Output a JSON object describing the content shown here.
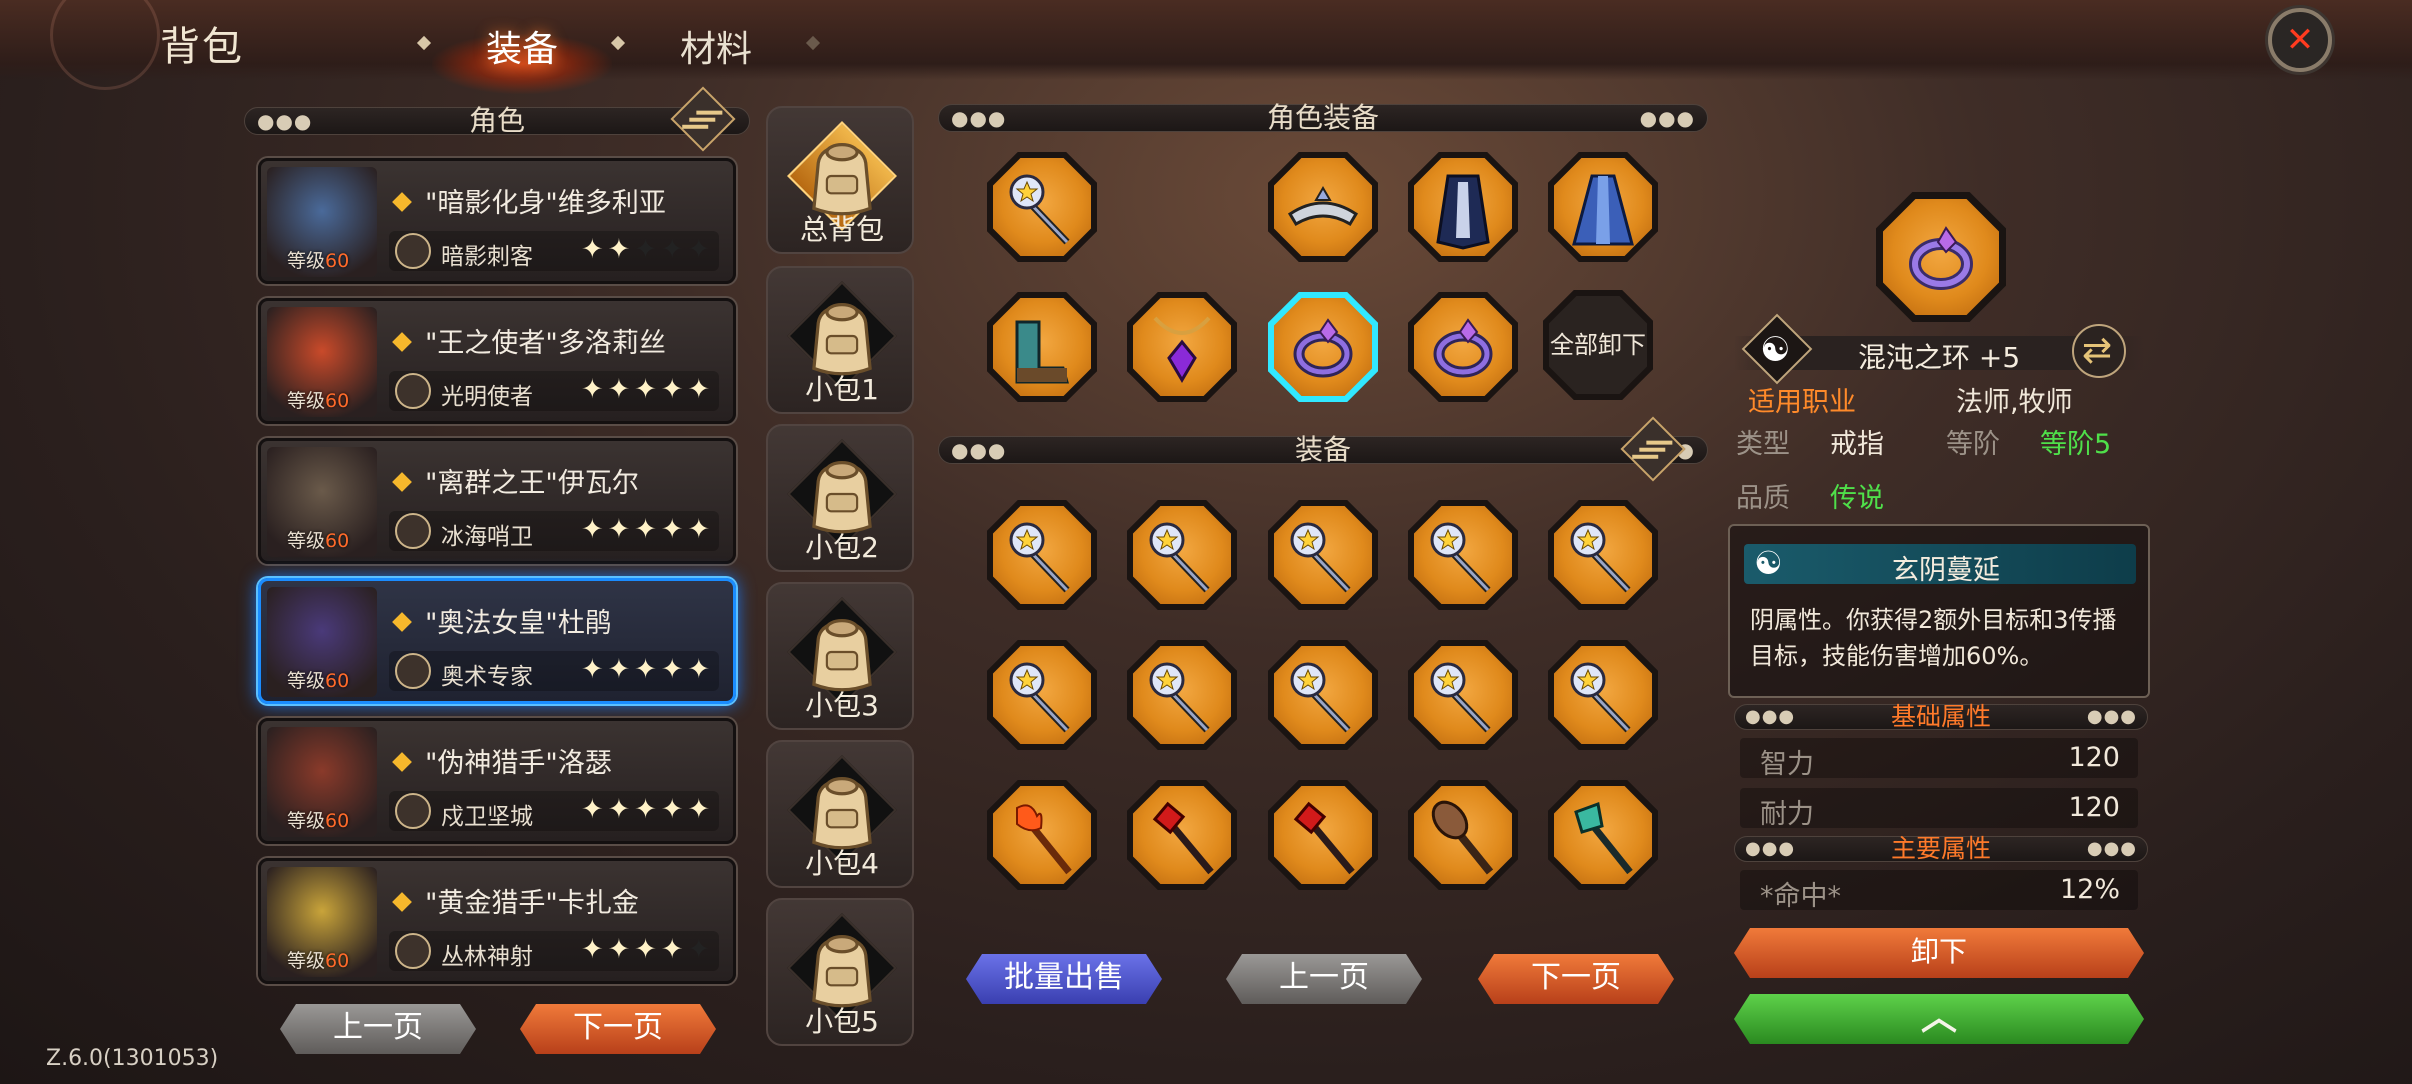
{
  "header": {
    "title": "背包",
    "tabs": [
      "装备",
      "材料"
    ],
    "active_tab": 0,
    "close_icon": "close-icon"
  },
  "left": {
    "section_title": "角色",
    "characters": [
      {
        "name": "\"暗影化身\"维多利亚",
        "level_label": "等级",
        "level": "60",
        "class": "暗影刺客",
        "stars": 2,
        "selected": false
      },
      {
        "name": "\"王之使者\"多洛莉丝",
        "level_label": "等级",
        "level": "60",
        "class": "光明使者",
        "stars": 5,
        "selected": false
      },
      {
        "name": "\"离群之王\"伊瓦尔",
        "level_label": "等级",
        "level": "60",
        "class": "冰海哨卫",
        "stars": 5,
        "selected": false
      },
      {
        "name": "\"奥法女皇\"杜鹃",
        "level_label": "等级",
        "level": "60",
        "class": "奥术专家",
        "stars": 5,
        "selected": true
      },
      {
        "name": "\"伪神猎手\"洛瑟",
        "level_label": "等级",
        "level": "60",
        "class": "戍卫坚城",
        "stars": 5,
        "selected": false
      },
      {
        "name": "\"黄金猎手\"卡扎金",
        "level_label": "等级",
        "level": "60",
        "class": "丛林神射",
        "stars": 4,
        "selected": false
      }
    ],
    "prev_label": "上一页",
    "next_label": "下一页"
  },
  "bags": [
    "总背包",
    "小包1",
    "小包2",
    "小包3",
    "小包4",
    "小包5"
  ],
  "equipped": {
    "section_title": "角色装备",
    "row1": [
      "staff-icon",
      "",
      "tiara-icon",
      "cloak-icon",
      "robe-icon"
    ],
    "row2": [
      "boots-icon",
      "amulet-icon",
      "ring-icon",
      "ring-icon"
    ],
    "unequip_all_label": "全部卸下"
  },
  "inventory": {
    "section_title": "装备",
    "items": [
      "staff-icon",
      "staff-icon",
      "staff-icon",
      "staff-icon",
      "staff-icon",
      "staff-icon",
      "staff-icon",
      "staff-icon",
      "staff-icon",
      "staff-icon",
      "fire-staff-icon",
      "red-wand-icon",
      "red-wand-icon",
      "club-icon",
      "jade-staff-icon"
    ],
    "bulk_sell_label": "批量出售",
    "prev_label": "上一页",
    "next_label": "下一页"
  },
  "detail": {
    "item_name": "混沌之环 +5",
    "class_label": "适用职业",
    "class_value": "法师,牧师",
    "type_label": "类型",
    "type_value": "戒指",
    "tier_label": "等阶",
    "tier_value": "等阶5",
    "quality_label": "品质",
    "quality_value": "传说",
    "effect_title": "玄阴蔓延",
    "effect_text": "阴属性。你获得2额外目标和3传播目标，技能伤害增加60%。",
    "basic_title": "基础属性",
    "basic_stats": [
      {
        "name": "智力",
        "value": "120"
      },
      {
        "name": "耐力",
        "value": "120"
      }
    ],
    "main_title": "主要属性",
    "main_stats": [
      {
        "name": "*命中*",
        "value": "12%"
      }
    ],
    "unequip_label": "卸下",
    "upgrade_icon": "chevron-up-icon"
  },
  "version": "Z.6.0(1301053)",
  "colors": {
    "accent_orange": "#ff7a2a",
    "selected_blue": "#1a8cff",
    "slot_orange": "#e08a1c",
    "quality_green": "#4fe04a"
  }
}
